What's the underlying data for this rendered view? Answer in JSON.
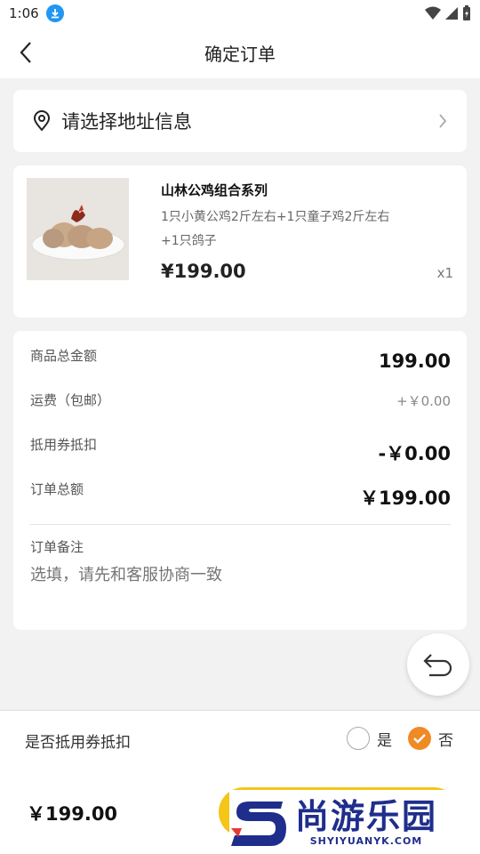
{
  "status_bar": {
    "time": "1:06"
  },
  "header": {
    "title": "确定订单"
  },
  "address": {
    "label": "请选择地址信息"
  },
  "product": {
    "name": "山林公鸡组合系列",
    "desc_line1": "1只小黄公鸡2斤左右+1只童子鸡2斤左右",
    "desc_line2": "+1只鸽子",
    "price": "¥199.00",
    "qty": "x1"
  },
  "summary": {
    "goods_total_label": "商品总金额",
    "goods_total_value": "199.00",
    "shipping_label": "运费（包邮）",
    "shipping_value": "+￥0.00",
    "coupon_label": "抵用券抵扣",
    "coupon_value": "-￥0.00",
    "order_total_label": "订单总额",
    "order_total_value": "￥199.00",
    "remark_label": "订单备注",
    "remark_placeholder": "选填，请先和客服协商一致"
  },
  "bottom": {
    "coupon_question": "是否抵用券抵扣",
    "option_yes": "是",
    "option_no": "否",
    "selected_option": "否",
    "total": "￥199.00"
  },
  "watermark": {
    "cn": "尚游乐园",
    "en": "SHYIYUANYK.COM"
  },
  "colors": {
    "accent_orange": "#f08a24",
    "button_yellow": "#f5c518",
    "watermark_blue": "#1f2e8c"
  }
}
